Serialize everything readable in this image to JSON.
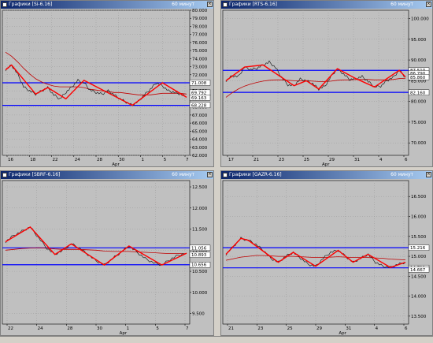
{
  "panels": [
    {
      "key": "si",
      "title": "Графики [Si-6.16]",
      "timeframe": "60 минут",
      "icon": "chart-window-icon",
      "price_labels": [
        "80.000",
        "79.000",
        "78.000",
        "77.000",
        "76.000",
        "75.000",
        "74.000",
        "73.000",
        "72.000",
        "71.000",
        "70.000",
        "69.000",
        "68.000",
        "67.000",
        "66.000",
        "65.000",
        "64.000",
        "63.000",
        "62.000"
      ],
      "badges": [
        {
          "text": "71.008",
          "color": "#ffffff"
        },
        {
          "text": "69.792",
          "color": "#ffffff"
        },
        {
          "text": "69.163",
          "color": "#ffffff"
        },
        {
          "text": "68.228",
          "color": "#ffffff"
        }
      ],
      "date_labels": [
        "16",
        "18",
        "22",
        "24",
        "28",
        "30",
        "1",
        "5",
        "7"
      ],
      "month_label": "Apr"
    },
    {
      "key": "rts",
      "title": "Графики [RTS-6.16]",
      "timeframe": "60 минут",
      "icon": "chart-window-icon",
      "price_labels": [
        "100.000",
        "95.000",
        "90.000",
        "85.000",
        "80.000",
        "75.000",
        "70.000"
      ],
      "badges": [
        {
          "text": "87.510",
          "color": "#ffffff"
        },
        {
          "text": "86.790",
          "color": "#ffffff"
        },
        {
          "text": "85.860",
          "color": "#ffffff"
        },
        {
          "text": "82.160",
          "color": "#ffffff"
        }
      ],
      "date_labels": [
        "17",
        "21",
        "23",
        "25",
        "29",
        "31",
        "4",
        "6"
      ],
      "month_label": "Apr"
    },
    {
      "key": "sbrf",
      "title": "Графики [SBRF-6.16]",
      "timeframe": "60 минут",
      "icon": "chart-window-icon",
      "price_labels": [
        "12.500",
        "12.000",
        "11.500",
        "11.000",
        "10.500",
        "10.000",
        "9.500"
      ],
      "badges": [
        {
          "text": "11.056",
          "color": "#ffffff"
        },
        {
          "text": "10.893",
          "color": "#ffffff"
        },
        {
          "text": "10.656",
          "color": "#ffffff"
        }
      ],
      "date_labels": [
        "22",
        "24",
        "28",
        "30",
        "1",
        "5",
        "7"
      ],
      "month_label": "Apr"
    },
    {
      "key": "gazr",
      "title": "Графики [GAZR-6.16]",
      "timeframe": "60 минут",
      "icon": "chart-window-icon",
      "price_labels": [
        "16.500",
        "16.000",
        "15.500",
        "15.000",
        "14.500",
        "14.000",
        "13.500"
      ],
      "badges": [
        {
          "text": "15.216",
          "color": "#ffffff"
        },
        {
          "text": "14.711",
          "color": "#ffffff"
        },
        {
          "text": "14.667",
          "color": "#ffffff"
        }
      ],
      "date_labels": [
        "21",
        "23",
        "25",
        "29",
        "31",
        "4",
        "6"
      ],
      "month_label": "Apr"
    }
  ],
  "chart_data": [
    {
      "type": "line",
      "title": "Графики [Si-6.16]",
      "y_ticks": [
        80,
        79,
        78,
        77,
        76,
        75,
        74,
        73,
        72,
        71,
        70,
        69,
        68,
        67,
        66,
        65,
        64,
        63,
        62
      ],
      "ylim": [
        62,
        80
      ],
      "x_ticks": [
        "16",
        "18",
        "22",
        "24",
        "28",
        "30",
        "1",
        "5",
        "7"
      ],
      "x_month": "Apr",
      "levels": {
        "upper": 71.0,
        "lower": 68.2
      },
      "price": [
        72.6,
        73.2,
        72.1,
        70.5,
        70.0,
        69.6,
        70.0,
        70.4,
        69.5,
        69.0,
        69.8,
        70.5,
        71.3,
        71.0,
        70.1,
        69.8,
        69.6,
        70.0,
        69.5,
        69.0,
        68.6,
        68.2,
        68.7,
        69.5,
        70.2,
        71.0,
        70.6,
        70.0,
        69.8,
        69.6,
        69.2
      ],
      "ma": [
        74.8,
        74.3,
        73.6,
        72.8,
        72.1,
        71.5,
        71.1,
        70.8,
        70.6,
        70.5,
        70.5,
        70.5,
        70.5,
        70.4,
        70.2,
        70.1,
        70.0,
        69.9,
        69.8,
        69.8,
        69.7,
        69.6,
        69.5,
        69.5,
        69.5,
        69.6,
        69.7,
        69.7,
        69.7,
        69.7,
        69.6
      ],
      "zigzag": [
        [
          0,
          72.6
        ],
        [
          1,
          73.2
        ],
        [
          5,
          69.6
        ],
        [
          7,
          70.4
        ],
        [
          10,
          69.0
        ],
        [
          13,
          71.3
        ],
        [
          21,
          68.2
        ],
        [
          26,
          71.0
        ],
        [
          30,
          69.2
        ]
      ]
    },
    {
      "type": "line",
      "title": "Графики [RTS-6.16]",
      "y_ticks": [
        100,
        95,
        90,
        85,
        80,
        75,
        70
      ],
      "ylim": [
        67,
        102
      ],
      "x_ticks": [
        "17",
        "21",
        "23",
        "25",
        "29",
        "31",
        "4",
        "6"
      ],
      "x_month": "Apr",
      "levels": {
        "upper": 87.5,
        "lower": 82.2
      },
      "price": [
        85.0,
        86.2,
        86.0,
        88.3,
        87.7,
        88.0,
        88.8,
        89.5,
        88.2,
        85.8,
        84.0,
        83.8,
        85.4,
        85.0,
        84.3,
        83.0,
        83.7,
        86.1,
        87.9,
        86.6,
        85.3,
        85.5,
        86.0,
        84.8,
        83.5,
        83.7,
        85.0,
        85.8,
        87.5,
        85.9
      ],
      "ma": [
        81.0,
        82.1,
        83.0,
        83.7,
        84.2,
        84.6,
        84.9,
        85.1,
        85.2,
        85.2,
        85.1,
        85.0,
        85.0,
        85.0,
        84.9,
        84.8,
        84.8,
        84.9,
        85.1,
        85.2,
        85.2,
        85.3,
        85.3,
        85.3,
        85.2,
        85.2,
        85.2,
        85.3,
        85.5,
        85.6
      ],
      "zigzag": [
        [
          0,
          85.0
        ],
        [
          3,
          88.3
        ],
        [
          6,
          88.8
        ],
        [
          11,
          83.8
        ],
        [
          13,
          85.0
        ],
        [
          15,
          83.0
        ],
        [
          18,
          87.9
        ],
        [
          21,
          85.5
        ],
        [
          24,
          83.5
        ],
        [
          28,
          87.5
        ],
        [
          29,
          85.9
        ]
      ]
    },
    {
      "type": "line",
      "title": "Графики [SBRF-6.16]",
      "y_ticks": [
        12.5,
        12.0,
        11.5,
        11.0,
        10.5,
        10.0,
        9.5
      ],
      "ylim": [
        9.25,
        12.65
      ],
      "x_ticks": [
        "22",
        "24",
        "28",
        "30",
        "1",
        "5",
        "7"
      ],
      "x_month": "Apr",
      "levels": {
        "upper": 11.056,
        "lower": 10.656
      },
      "price": [
        11.2,
        11.35,
        11.45,
        11.55,
        11.3,
        11.05,
        10.9,
        11.0,
        11.15,
        11.05,
        10.9,
        10.75,
        10.65,
        10.8,
        10.95,
        11.1,
        10.95,
        10.8,
        10.7,
        10.65,
        10.78,
        10.88,
        10.93
      ],
      "ma": [
        11.0,
        11.02,
        11.04,
        11.05,
        11.06,
        11.05,
        11.03,
        11.02,
        11.02,
        11.02,
        11.01,
        11.0,
        10.98,
        10.97,
        10.97,
        10.97,
        10.96,
        10.95,
        10.94,
        10.93,
        10.92,
        10.92,
        10.92
      ],
      "zigzag": [
        [
          0,
          11.2
        ],
        [
          3,
          11.55
        ],
        [
          6,
          10.9
        ],
        [
          8,
          11.15
        ],
        [
          12,
          10.65
        ],
        [
          15,
          11.1
        ],
        [
          19,
          10.65
        ],
        [
          22,
          10.93
        ]
      ]
    },
    {
      "type": "line",
      "title": "Графики [GAZR-6.16]",
      "y_ticks": [
        16.5,
        16.0,
        15.5,
        15.0,
        14.5,
        14.0,
        13.5
      ],
      "ylim": [
        13.3,
        16.9
      ],
      "x_ticks": [
        "21",
        "23",
        "25",
        "29",
        "31",
        "4",
        "6"
      ],
      "x_month": "Apr",
      "levels": {
        "upper": 15.216,
        "lower": 14.711
      },
      "price": [
        15.05,
        15.25,
        15.45,
        15.4,
        15.3,
        15.15,
        14.95,
        14.85,
        15.0,
        15.1,
        14.95,
        14.8,
        14.75,
        14.95,
        15.1,
        15.15,
        15.0,
        14.85,
        14.95,
        15.05,
        14.85,
        14.75,
        14.72,
        14.8,
        14.85
      ],
      "ma": [
        14.9,
        14.94,
        14.98,
        15.0,
        15.02,
        15.02,
        15.01,
        15.0,
        15.0,
        15.0,
        14.99,
        14.98,
        14.97,
        14.97,
        14.98,
        14.99,
        14.98,
        14.97,
        14.97,
        14.97,
        14.96,
        14.95,
        14.93,
        14.92,
        14.91
      ],
      "zigzag": [
        [
          0,
          15.05
        ],
        [
          2,
          15.45
        ],
        [
          3,
          15.4
        ],
        [
          7,
          14.85
        ],
        [
          9,
          15.1
        ],
        [
          12,
          14.75
        ],
        [
          15,
          15.15
        ],
        [
          17,
          14.85
        ],
        [
          19,
          15.05
        ],
        [
          22,
          14.72
        ],
        [
          24,
          14.85
        ]
      ]
    }
  ]
}
